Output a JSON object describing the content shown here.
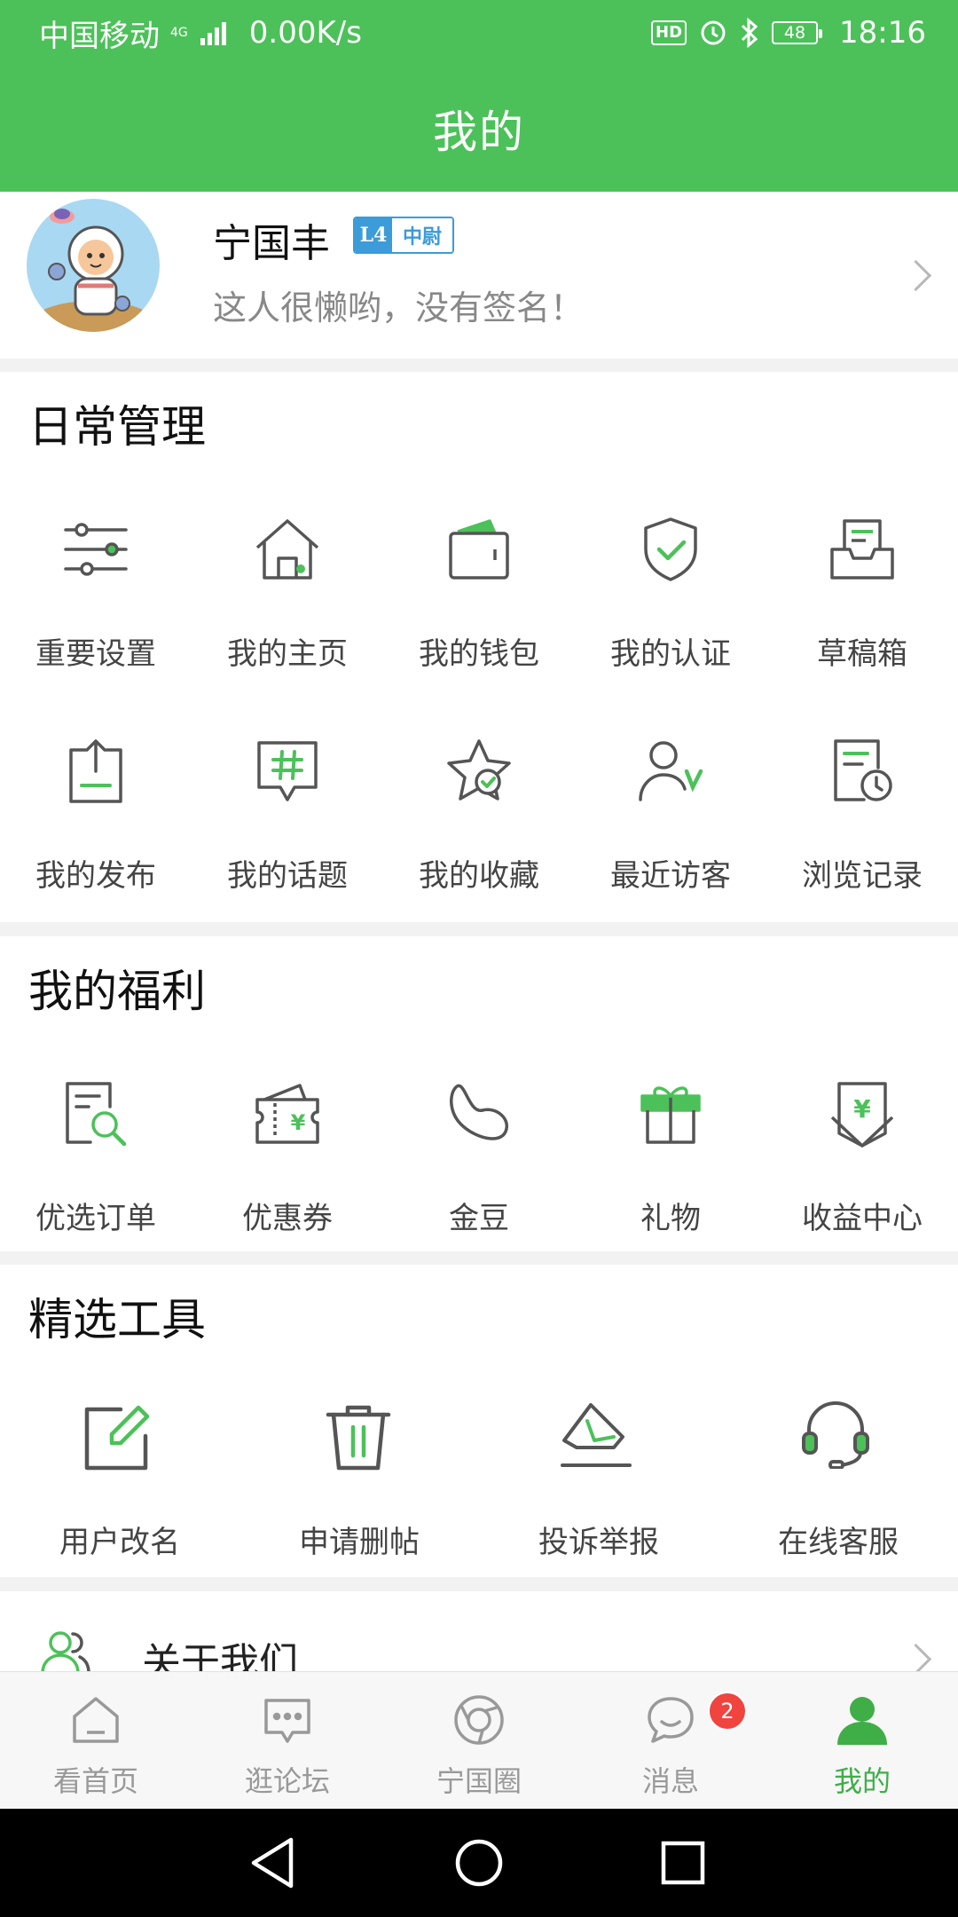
{
  "status_bar": {
    "carrier": "中国移动",
    "network": "4G",
    "speed": "0.00K/s",
    "hd": "HD",
    "battery": "48",
    "time": "18:16"
  },
  "header": {
    "title": "我的"
  },
  "profile": {
    "name": "宁国丰",
    "level": "L4",
    "rank": "中尉",
    "signature": "这人很懒哟，没有签名！"
  },
  "daily": {
    "title": "日常管理",
    "items": [
      {
        "label": "重要设置",
        "icon": "sliders-icon"
      },
      {
        "label": "我的主页",
        "icon": "home-icon"
      },
      {
        "label": "我的钱包",
        "icon": "wallet-icon"
      },
      {
        "label": "我的认证",
        "icon": "shield-check-icon"
      },
      {
        "label": "草稿箱",
        "icon": "drafts-icon"
      },
      {
        "label": "我的发布",
        "icon": "upload-icon"
      },
      {
        "label": "我的话题",
        "icon": "hashtag-icon"
      },
      {
        "label": "我的收藏",
        "icon": "star-icon"
      },
      {
        "label": "最近访客",
        "icon": "visitor-icon"
      },
      {
        "label": "浏览记录",
        "icon": "history-icon"
      }
    ]
  },
  "welfare": {
    "title": "我的福利",
    "items": [
      {
        "label": "优选订单",
        "icon": "order-search-icon"
      },
      {
        "label": "优惠券",
        "icon": "coupon-icon"
      },
      {
        "label": "金豆",
        "icon": "bean-icon"
      },
      {
        "label": "礼物",
        "icon": "gift-icon"
      },
      {
        "label": "收益中心",
        "icon": "income-icon"
      }
    ]
  },
  "tools": {
    "title": "精选工具",
    "items": [
      {
        "label": "用户改名",
        "icon": "edit-icon"
      },
      {
        "label": "申请删帖",
        "icon": "trash-icon"
      },
      {
        "label": "投诉举报",
        "icon": "report-icon"
      },
      {
        "label": "在线客服",
        "icon": "headset-icon"
      }
    ]
  },
  "about": {
    "label": "关于我们"
  },
  "tabs": [
    {
      "label": "看首页",
      "icon": "home-tab-icon"
    },
    {
      "label": "逛论坛",
      "icon": "forum-tab-icon"
    },
    {
      "label": "宁国圈",
      "icon": "circle-tab-icon"
    },
    {
      "label": "消息",
      "icon": "message-tab-icon",
      "badge": "2"
    },
    {
      "label": "我的",
      "icon": "me-tab-icon"
    }
  ],
  "colors": {
    "brand_green": "#4cc159",
    "accent_green": "#3fae47",
    "badge_red": "#f0443f",
    "rank_blue": "#3c9bd9"
  }
}
